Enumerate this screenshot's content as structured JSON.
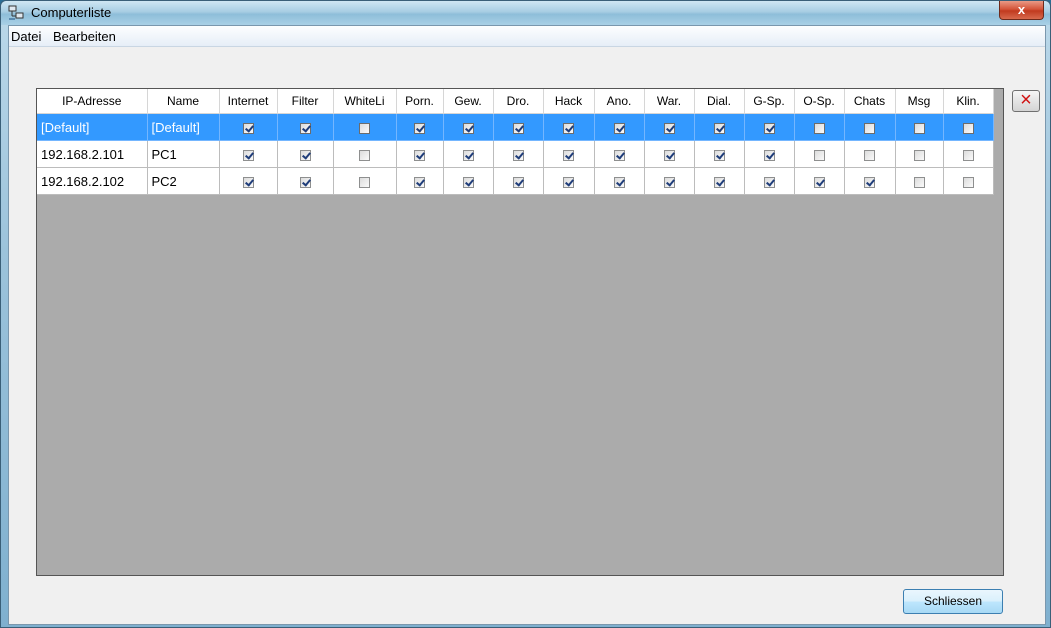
{
  "window": {
    "title": "Computerliste",
    "close_label": "x"
  },
  "menu": [
    "Datei",
    "Bearbeiten"
  ],
  "table": {
    "ip_header": "IP-Adresse",
    "name_header": "Name",
    "flag_headers": [
      "Internet",
      "Filter",
      "WhiteLi",
      "Porn.",
      "Gew.",
      "Dro.",
      "Hack",
      "Ano.",
      "War.",
      "Dial.",
      "G-Sp.",
      "O-Sp.",
      "Chats",
      "Msg",
      "Klin."
    ],
    "rows": [
      {
        "ip": "[Default]",
        "name": "[Default]",
        "selected": true,
        "flags": [
          true,
          true,
          false,
          true,
          true,
          true,
          true,
          true,
          true,
          true,
          true,
          false,
          false,
          false,
          false
        ]
      },
      {
        "ip": "192.168.2.101",
        "name": "PC1",
        "selected": false,
        "flags": [
          true,
          true,
          false,
          true,
          true,
          true,
          true,
          true,
          true,
          true,
          true,
          false,
          false,
          false,
          false
        ]
      },
      {
        "ip": "192.168.2.102",
        "name": "PC2",
        "selected": false,
        "flags": [
          true,
          true,
          false,
          true,
          true,
          true,
          true,
          true,
          true,
          true,
          true,
          true,
          true,
          false,
          false
        ]
      }
    ]
  },
  "buttons": {
    "delete_icon": "×",
    "close_label": "Schliessen"
  },
  "colors": {
    "selection": "#3399ff",
    "grid_background": "#ababab",
    "delete_icon": "#d01010"
  }
}
